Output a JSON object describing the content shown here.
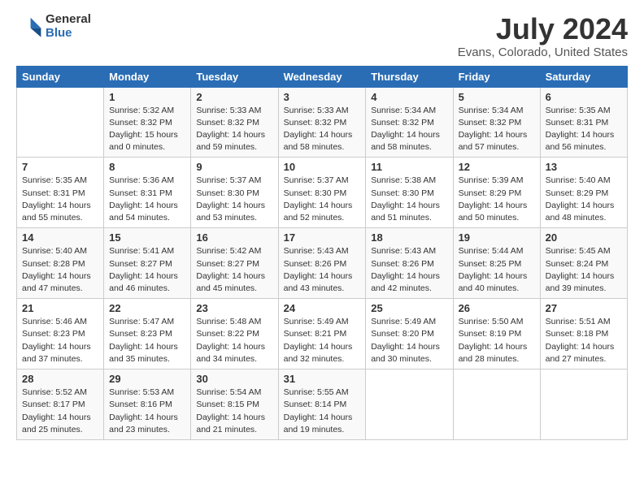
{
  "header": {
    "logo_general": "General",
    "logo_blue": "Blue",
    "main_title": "July 2024",
    "subtitle": "Evans, Colorado, United States"
  },
  "calendar": {
    "days_of_week": [
      "Sunday",
      "Monday",
      "Tuesday",
      "Wednesday",
      "Thursday",
      "Friday",
      "Saturday"
    ],
    "weeks": [
      [
        {
          "day": "",
          "info": ""
        },
        {
          "day": "1",
          "info": "Sunrise: 5:32 AM\nSunset: 8:32 PM\nDaylight: 15 hours\nand 0 minutes."
        },
        {
          "day": "2",
          "info": "Sunrise: 5:33 AM\nSunset: 8:32 PM\nDaylight: 14 hours\nand 59 minutes."
        },
        {
          "day": "3",
          "info": "Sunrise: 5:33 AM\nSunset: 8:32 PM\nDaylight: 14 hours\nand 58 minutes."
        },
        {
          "day": "4",
          "info": "Sunrise: 5:34 AM\nSunset: 8:32 PM\nDaylight: 14 hours\nand 58 minutes."
        },
        {
          "day": "5",
          "info": "Sunrise: 5:34 AM\nSunset: 8:32 PM\nDaylight: 14 hours\nand 57 minutes."
        },
        {
          "day": "6",
          "info": "Sunrise: 5:35 AM\nSunset: 8:31 PM\nDaylight: 14 hours\nand 56 minutes."
        }
      ],
      [
        {
          "day": "7",
          "info": "Sunrise: 5:35 AM\nSunset: 8:31 PM\nDaylight: 14 hours\nand 55 minutes."
        },
        {
          "day": "8",
          "info": "Sunrise: 5:36 AM\nSunset: 8:31 PM\nDaylight: 14 hours\nand 54 minutes."
        },
        {
          "day": "9",
          "info": "Sunrise: 5:37 AM\nSunset: 8:30 PM\nDaylight: 14 hours\nand 53 minutes."
        },
        {
          "day": "10",
          "info": "Sunrise: 5:37 AM\nSunset: 8:30 PM\nDaylight: 14 hours\nand 52 minutes."
        },
        {
          "day": "11",
          "info": "Sunrise: 5:38 AM\nSunset: 8:30 PM\nDaylight: 14 hours\nand 51 minutes."
        },
        {
          "day": "12",
          "info": "Sunrise: 5:39 AM\nSunset: 8:29 PM\nDaylight: 14 hours\nand 50 minutes."
        },
        {
          "day": "13",
          "info": "Sunrise: 5:40 AM\nSunset: 8:29 PM\nDaylight: 14 hours\nand 48 minutes."
        }
      ],
      [
        {
          "day": "14",
          "info": "Sunrise: 5:40 AM\nSunset: 8:28 PM\nDaylight: 14 hours\nand 47 minutes."
        },
        {
          "day": "15",
          "info": "Sunrise: 5:41 AM\nSunset: 8:27 PM\nDaylight: 14 hours\nand 46 minutes."
        },
        {
          "day": "16",
          "info": "Sunrise: 5:42 AM\nSunset: 8:27 PM\nDaylight: 14 hours\nand 45 minutes."
        },
        {
          "day": "17",
          "info": "Sunrise: 5:43 AM\nSunset: 8:26 PM\nDaylight: 14 hours\nand 43 minutes."
        },
        {
          "day": "18",
          "info": "Sunrise: 5:43 AM\nSunset: 8:26 PM\nDaylight: 14 hours\nand 42 minutes."
        },
        {
          "day": "19",
          "info": "Sunrise: 5:44 AM\nSunset: 8:25 PM\nDaylight: 14 hours\nand 40 minutes."
        },
        {
          "day": "20",
          "info": "Sunrise: 5:45 AM\nSunset: 8:24 PM\nDaylight: 14 hours\nand 39 minutes."
        }
      ],
      [
        {
          "day": "21",
          "info": "Sunrise: 5:46 AM\nSunset: 8:23 PM\nDaylight: 14 hours\nand 37 minutes."
        },
        {
          "day": "22",
          "info": "Sunrise: 5:47 AM\nSunset: 8:23 PM\nDaylight: 14 hours\nand 35 minutes."
        },
        {
          "day": "23",
          "info": "Sunrise: 5:48 AM\nSunset: 8:22 PM\nDaylight: 14 hours\nand 34 minutes."
        },
        {
          "day": "24",
          "info": "Sunrise: 5:49 AM\nSunset: 8:21 PM\nDaylight: 14 hours\nand 32 minutes."
        },
        {
          "day": "25",
          "info": "Sunrise: 5:49 AM\nSunset: 8:20 PM\nDaylight: 14 hours\nand 30 minutes."
        },
        {
          "day": "26",
          "info": "Sunrise: 5:50 AM\nSunset: 8:19 PM\nDaylight: 14 hours\nand 28 minutes."
        },
        {
          "day": "27",
          "info": "Sunrise: 5:51 AM\nSunset: 8:18 PM\nDaylight: 14 hours\nand 27 minutes."
        }
      ],
      [
        {
          "day": "28",
          "info": "Sunrise: 5:52 AM\nSunset: 8:17 PM\nDaylight: 14 hours\nand 25 minutes."
        },
        {
          "day": "29",
          "info": "Sunrise: 5:53 AM\nSunset: 8:16 PM\nDaylight: 14 hours\nand 23 minutes."
        },
        {
          "day": "30",
          "info": "Sunrise: 5:54 AM\nSunset: 8:15 PM\nDaylight: 14 hours\nand 21 minutes."
        },
        {
          "day": "31",
          "info": "Sunrise: 5:55 AM\nSunset: 8:14 PM\nDaylight: 14 hours\nand 19 minutes."
        },
        {
          "day": "",
          "info": ""
        },
        {
          "day": "",
          "info": ""
        },
        {
          "day": "",
          "info": ""
        }
      ]
    ]
  }
}
